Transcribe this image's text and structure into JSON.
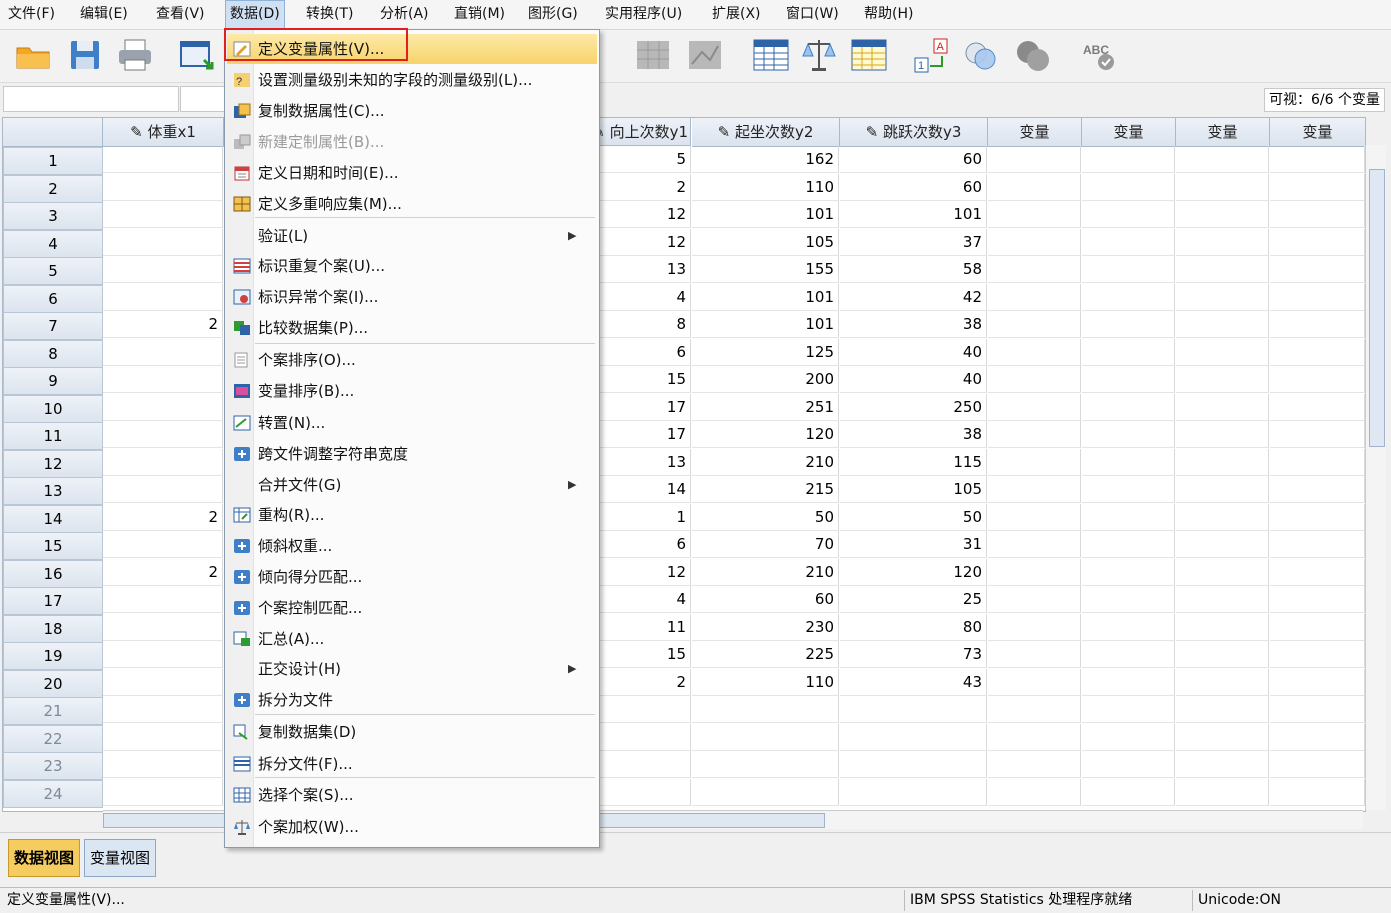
{
  "menubar": [
    {
      "label": "文件(F)"
    },
    {
      "label": "编辑(E)"
    },
    {
      "label": "查看(V)"
    },
    {
      "label": "数据(D)"
    },
    {
      "label": "转换(T)"
    },
    {
      "label": "分析(A)"
    },
    {
      "label": "直销(M)"
    },
    {
      "label": "图形(G)"
    },
    {
      "label": "实用程序(U)"
    },
    {
      "label": "扩展(X)"
    },
    {
      "label": "窗口(W)"
    },
    {
      "label": "帮助(H)"
    }
  ],
  "toolbar": {
    "icons": [
      "open-folder",
      "save",
      "print",
      "dialog-recall",
      "weight-cases",
      "split-file",
      "value-labels",
      "balance",
      "select-cases",
      "value-labels-toggle",
      "circles",
      "sets",
      "spell-check"
    ]
  },
  "visible_info": "可视：6/6 个变量",
  "grid": {
    "columns": [
      {
        "label": "体重x1",
        "measure": "scale"
      },
      {
        "label": "向上次数y1",
        "measure": "scale"
      },
      {
        "label": "起坐次数y2",
        "measure": "scale"
      },
      {
        "label": "跳跃次数y3",
        "measure": "scale"
      },
      {
        "label": "变量"
      },
      {
        "label": "变量"
      },
      {
        "label": "变量"
      },
      {
        "label": "变量"
      }
    ],
    "row_numbers": [
      "1",
      "2",
      "3",
      "4",
      "5",
      "6",
      "7",
      "8",
      "9",
      "10",
      "11",
      "12",
      "13",
      "14",
      "15",
      "16",
      "17",
      "18",
      "19",
      "20",
      "21",
      "22",
      "23",
      "24"
    ],
    "y1": [
      "5",
      "2",
      "12",
      "12",
      "13",
      "4",
      "8",
      "6",
      "15",
      "17",
      "17",
      "13",
      "14",
      "1",
      "6",
      "12",
      "4",
      "11",
      "15",
      "2"
    ],
    "y2": [
      "162",
      "110",
      "101",
      "105",
      "155",
      "101",
      "101",
      "125",
      "200",
      "251",
      "120",
      "210",
      "215",
      "50",
      "70",
      "210",
      "60",
      "230",
      "225",
      "110"
    ],
    "y3": [
      "60",
      "60",
      "101",
      "37",
      "58",
      "42",
      "38",
      "40",
      "40",
      "250",
      "38",
      "115",
      "105",
      "50",
      "31",
      "120",
      "25",
      "80",
      "73",
      "43"
    ],
    "x1_peek": [
      "",
      "",
      "",
      "",
      "",
      "",
      "2",
      "",
      "",
      "",
      "",
      "",
      "",
      "2",
      "",
      "2",
      "",
      "",
      "",
      ""
    ]
  },
  "data_menu": {
    "items": [
      {
        "label": "定义变量属性(V)...",
        "icon": "define-properties-icon",
        "highlighted": true
      },
      {
        "label": "设置测量级别未知的字段的测量级别(L)...",
        "icon": "measure-level-icon"
      },
      {
        "label": "复制数据属性(C)...",
        "icon": "copy-properties-icon"
      },
      {
        "label": "新建定制属性(B)...",
        "icon": "custom-attribute-icon",
        "disabled": true
      },
      {
        "label": "定义日期和时间(E)...",
        "icon": "calendar-icon"
      },
      {
        "label": "定义多重响应集(M)...",
        "icon": "multiple-response-icon"
      },
      {
        "label": "验证(L)",
        "submenu": true
      },
      {
        "label": "标识重复个案(U)...",
        "icon": "duplicate-cases-icon"
      },
      {
        "label": "标识异常个案(I)...",
        "icon": "unusual-cases-icon"
      },
      {
        "label": "比较数据集(P)...",
        "icon": "compare-datasets-icon"
      },
      {
        "label": "个案排序(O)...",
        "icon": "sort-cases-icon"
      },
      {
        "label": "变量排序(B)...",
        "icon": "sort-variables-icon"
      },
      {
        "label": "转置(N)...",
        "icon": "transpose-icon"
      },
      {
        "label": "跨文件调整字符串宽度",
        "icon": "plus-icon"
      },
      {
        "label": "合并文件(G)",
        "submenu": true
      },
      {
        "label": "重构(R)...",
        "icon": "restructure-icon"
      },
      {
        "label": "倾斜权重...",
        "icon": "plus-icon"
      },
      {
        "label": "倾向得分匹配...",
        "icon": "plus-icon"
      },
      {
        "label": "个案控制匹配...",
        "icon": "plus-icon"
      },
      {
        "label": "汇总(A)...",
        "icon": "aggregate-icon"
      },
      {
        "label": "正交设计(H)",
        "submenu": true
      },
      {
        "label": "拆分为文件",
        "icon": "plus-icon"
      },
      {
        "label": "复制数据集(D)",
        "icon": "copy-dataset-icon"
      },
      {
        "label": "拆分文件(F)...",
        "icon": "split-file-icon"
      },
      {
        "label": "选择个案(S)...",
        "icon": "select-cases-icon"
      },
      {
        "label": "个案加权(W)...",
        "icon": "weight-cases-icon"
      }
    ]
  },
  "tabs": {
    "data_view": "数据视图",
    "variable_view": "变量视图"
  },
  "status": {
    "left": "定义变量属性(V)...",
    "processor": "IBM SPSS Statistics 处理程序就绪",
    "unicode": "Unicode:ON"
  },
  "colors": {
    "highlight": "#f7d36a",
    "red_box": "#e02020",
    "tab_active": "#f4cc60",
    "header_blue": "#dbe3ee"
  }
}
